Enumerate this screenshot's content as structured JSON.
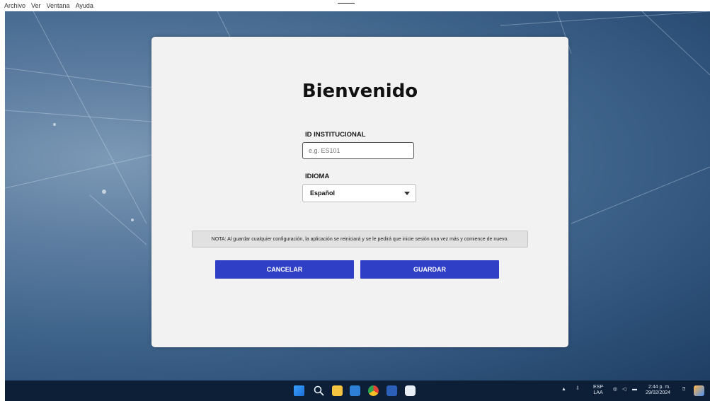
{
  "menubar": {
    "items": [
      "Archivo",
      "Ver",
      "Ventana",
      "Ayuda"
    ]
  },
  "dialog": {
    "title": "Bienvenido",
    "institutional_id": {
      "label": "ID INSTITUCIONAL",
      "value": "",
      "placeholder": "e.g. ES101"
    },
    "language": {
      "label": "IDIOMA",
      "selected": "Español"
    },
    "note": "NOTA: Al guardar cualquier configuración, la aplicación se reiniciará y se le pedirá que inicie sesión una vez más y comience de nuevo.",
    "cancel_label": "CANCELAR",
    "save_label": "GUARDAR",
    "accent_color": "#2f3fc6"
  },
  "taskbar": {
    "apps": [
      "windows-start-icon",
      "search-icon",
      "file-explorer-icon",
      "mail-icon",
      "chrome-icon",
      "word-icon",
      "app-icon"
    ],
    "tray": {
      "language_top": "ESP",
      "language_bottom": "LAA",
      "time": "2:44 p. m.",
      "date": "29/02/2024"
    }
  }
}
